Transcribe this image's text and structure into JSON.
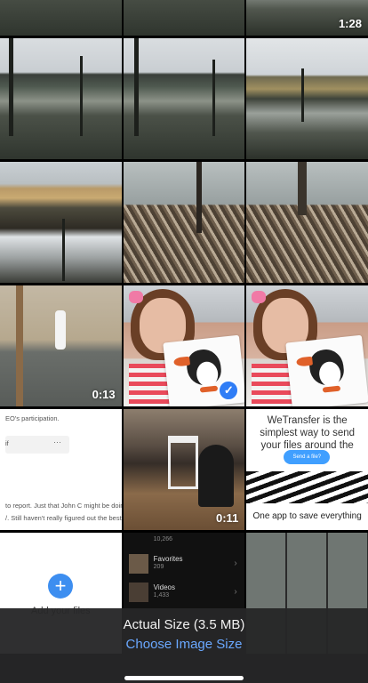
{
  "grid": {
    "row0": {
      "c2_duration": "1:28"
    },
    "row3": {
      "c0_duration": "0:13"
    },
    "row4": {
      "doc_line1": "EO's participation.",
      "doc_line2": "if",
      "doc_dots": "···",
      "doc_line3": "to report. Just that John C might be doing some",
      "doc_line4": "/. Still haven't really figured out the best way to",
      "c1_duration": "0:11",
      "wt_title": "WeTransfer is the simplest way to send your files around the world",
      "wt_button": "Send a file?",
      "wt_tagline": "One app to save everything"
    },
    "row5": {
      "add_label": "Add your files",
      "albums_top": "10,266",
      "albums": [
        {
          "name": "Favorites",
          "count": "209"
        },
        {
          "name": "Videos",
          "count": "1,433"
        }
      ]
    }
  },
  "sheet": {
    "title": "Actual Size (3.5 MB)",
    "link": "Choose Image Size"
  },
  "colors": {
    "accent": "#6aa8ff",
    "check": "#2f7df6"
  }
}
